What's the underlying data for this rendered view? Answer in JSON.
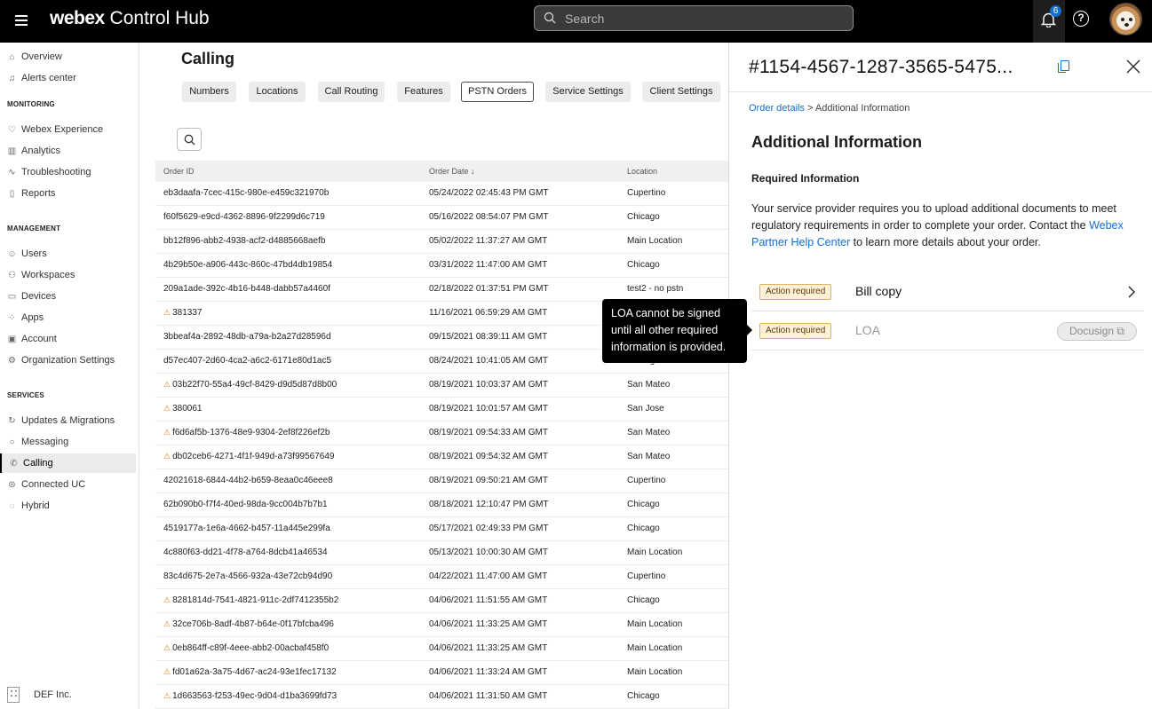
{
  "app": {
    "brand": "webex",
    "product": "Control Hub"
  },
  "search": {
    "placeholder": "Search"
  },
  "notifications": {
    "count": "6"
  },
  "help": {
    "label": "?"
  },
  "sidebar": {
    "top": [
      {
        "label": "Overview",
        "icon": "home-icon"
      },
      {
        "label": "Alerts center",
        "icon": "bell-icon"
      }
    ],
    "monitoring_title": "MONITORING",
    "monitoring": [
      {
        "label": "Webex Experience",
        "icon": "heart-icon"
      },
      {
        "label": "Analytics",
        "icon": "analytics-icon"
      },
      {
        "label": "Troubleshooting",
        "icon": "pulse-icon"
      },
      {
        "label": "Reports",
        "icon": "report-icon"
      }
    ],
    "management_title": "MANAGEMENT",
    "management": [
      {
        "label": "Users",
        "icon": "user-icon"
      },
      {
        "label": "Workspaces",
        "icon": "workspaces-icon"
      },
      {
        "label": "Devices",
        "icon": "devices-icon"
      },
      {
        "label": "Apps",
        "icon": "apps-icon"
      },
      {
        "label": "Account",
        "icon": "account-icon"
      },
      {
        "label": "Organization Settings",
        "icon": "gear-icon"
      }
    ],
    "services_title": "SERVICES",
    "services": [
      {
        "label": "Updates & Migrations",
        "icon": "refresh-icon"
      },
      {
        "label": "Messaging",
        "icon": "chat-icon"
      },
      {
        "label": "Calling",
        "icon": "phone-icon",
        "active": true
      },
      {
        "label": "Connected UC",
        "icon": "cloud-icon"
      },
      {
        "label": "Hybrid",
        "icon": "hybrid-icon"
      }
    ],
    "org_name": "DEF Inc."
  },
  "main": {
    "title": "Calling",
    "tabs": [
      "Numbers",
      "Locations",
      "Call Routing",
      "Features",
      "PSTN Orders",
      "Service Settings",
      "Client Settings"
    ],
    "active_tab": "PSTN Orders",
    "columns": [
      "Order ID",
      "Order Date ↓",
      "Location"
    ],
    "rows": [
      {
        "id": "eb3daafa-7cec-415c-980e-e459c321970b",
        "date": "05/24/2022 02:45:43 PM GMT",
        "location": "Cupertino",
        "warn": false
      },
      {
        "id": "f60f5629-e9cd-4362-8896-9f2299d6c719",
        "date": "05/16/2022 08:54:07 PM GMT",
        "location": "Chicago",
        "warn": false
      },
      {
        "id": "bb12f896-abb2-4938-acf2-d4885668aefb",
        "date": "05/02/2022 11:37:27 AM GMT",
        "location": "Main Location",
        "warn": false
      },
      {
        "id": "4b29b50e-a906-443c-860c-47bd4db19854",
        "date": "03/31/2022 11:47:00 AM GMT",
        "location": "Chicago",
        "warn": false
      },
      {
        "id": "209a1ade-392c-4b16-b448-dabb57a4460f",
        "date": "02/18/2022 01:37:51 PM GMT",
        "location": "test2 - no pstn",
        "warn": false
      },
      {
        "id": "381337",
        "date": "11/16/2021 06:59:29 AM GMT",
        "location": "",
        "warn": true
      },
      {
        "id": "3bbeaf4a-2892-48db-a79a-b2a27d28596d",
        "date": "09/15/2021 08:39:11 AM GMT",
        "location": "",
        "warn": false
      },
      {
        "id": "d57ec407-2d60-4ca2-a6c2-6171e80d1ac5",
        "date": "08/24/2021 10:41:05 AM GMT",
        "location": "Chicago",
        "warn": false
      },
      {
        "id": "03b22f70-55a4-49cf-8429-d9d5d87d8b00",
        "date": "08/19/2021 10:03:37 AM GMT",
        "location": "San Mateo",
        "warn": true
      },
      {
        "id": "380061",
        "date": "08/19/2021 10:01:57 AM GMT",
        "location": "San Jose",
        "warn": true
      },
      {
        "id": "f6d6af5b-1376-48e9-9304-2ef8f226ef2b",
        "date": "08/19/2021 09:54:33 AM GMT",
        "location": "San Mateo",
        "warn": true
      },
      {
        "id": "db02ceb6-4271-4f1f-949d-a73f99567649",
        "date": "08/19/2021 09:54:32 AM GMT",
        "location": "San Mateo",
        "warn": true
      },
      {
        "id": "42021618-6844-44b2-b659-8eaa0c46eee8",
        "date": "08/19/2021 09:50:21 AM GMT",
        "location": "Cupertino",
        "warn": false
      },
      {
        "id": "62b090b0-f7f4-40ed-98da-9cc004b7b7b1",
        "date": "08/18/2021 12:10:47 PM GMT",
        "location": "Chicago",
        "warn": false
      },
      {
        "id": "4519177a-1e6a-4662-b457-11a445e299fa",
        "date": "05/17/2021 02:49:33 PM GMT",
        "location": "Chicago",
        "warn": false
      },
      {
        "id": "4c880f63-dd21-4f78-a764-8dcb41a46534",
        "date": "05/13/2021 10:00:30 AM GMT",
        "location": "Main Location",
        "warn": false
      },
      {
        "id": "83c4d675-2e7a-4566-932a-43e72cb94d90",
        "date": "04/22/2021 11:47:00 AM GMT",
        "location": "Cupertino",
        "warn": false
      },
      {
        "id": "8281814d-7541-4821-911c-2df7412355b2",
        "date": "04/06/2021 11:51:55 AM GMT",
        "location": "Chicago",
        "warn": true
      },
      {
        "id": "32ce706b-8adf-4b87-b64e-0f17bfcba496",
        "date": "04/06/2021 11:33:25 AM GMT",
        "location": "Main Location",
        "warn": true
      },
      {
        "id": "0eb864ff-c89f-4eee-abb2-00acbaf458f0",
        "date": "04/06/2021 11:33:25 AM GMT",
        "location": "Main Location",
        "warn": true
      },
      {
        "id": "fd01a62a-3a75-4d67-ac24-93e1fec17132",
        "date": "04/06/2021 11:33:24 AM GMT",
        "location": "Main Location",
        "warn": true
      },
      {
        "id": "1d663563-f253-49ec-9d04-d1ba3699fd73",
        "date": "04/06/2021 11:31:50 AM GMT",
        "location": "Chicago",
        "warn": true
      }
    ]
  },
  "panel": {
    "title": "#1154-4567-1287-3565-5475...",
    "breadcrumb_link": "Order details",
    "breadcrumb_sep": " > ",
    "breadcrumb_current": "Additional Information",
    "heading": "Additional  Information",
    "subheading": "Required Information",
    "desc_text": "Your service provider requires you to upload additional documents to meet regulatory requirements in order to complete your order. Contact the ",
    "desc_link": "Webex Partner Help Center",
    "desc_tail": " to learn more details about your order.",
    "items": [
      {
        "status": "Action required",
        "name": "Bill copy"
      },
      {
        "status": "Action required",
        "name": "LOA",
        "action": "Docusign"
      }
    ]
  },
  "tooltip": {
    "lines": [
      "LOA cannot be signed",
      "until all other required",
      "information is provided."
    ]
  },
  "colors": {
    "accent": "#1170cf",
    "warning": "#d9841b",
    "topbar": "#000000"
  }
}
